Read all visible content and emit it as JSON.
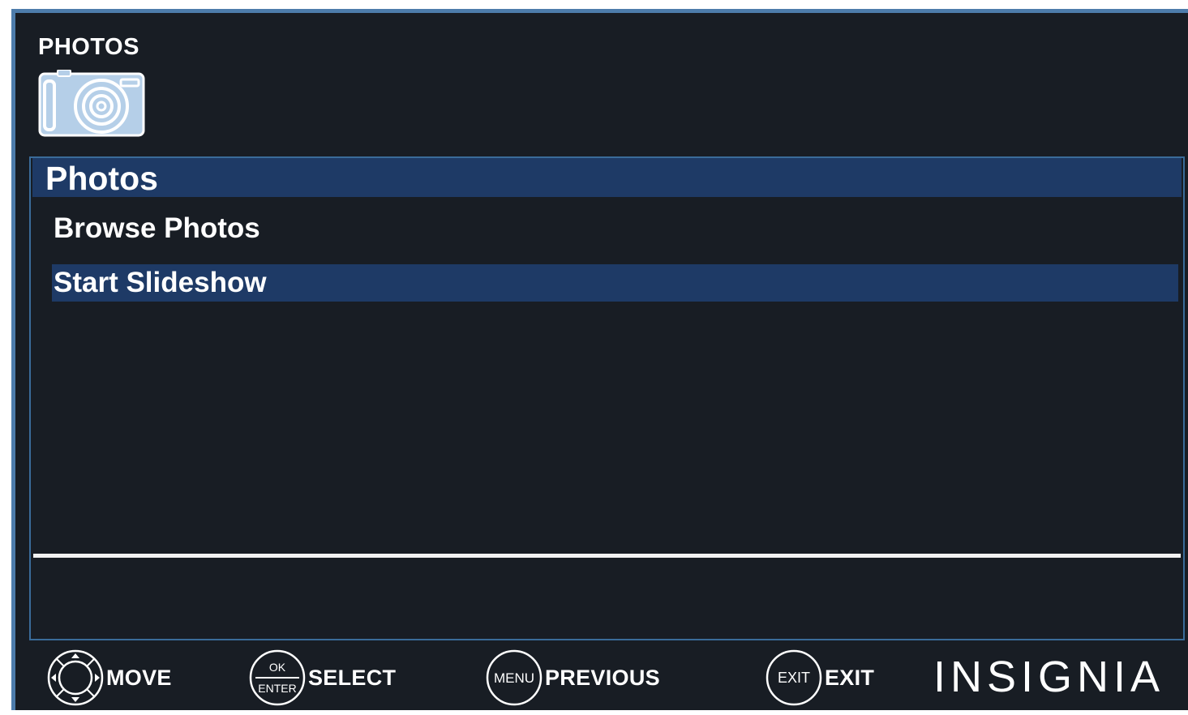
{
  "header": {
    "title": "PHOTOS",
    "icon": "camera-icon"
  },
  "panel": {
    "title": "Photos",
    "items": [
      {
        "label": "Browse Photos",
        "selected": false
      },
      {
        "label": "Start Slideshow",
        "selected": true
      }
    ]
  },
  "footer": {
    "hints": [
      {
        "icon": "dpad-icon",
        "label": "MOVE"
      },
      {
        "icon": "ok-enter-icon",
        "icon_text_top": "OK",
        "icon_text_bottom": "ENTER",
        "label": "SELECT"
      },
      {
        "icon": "menu-button-icon",
        "icon_text": "MENU",
        "label": "PREVIOUS"
      },
      {
        "icon": "exit-button-icon",
        "icon_text": "EXIT",
        "label": "EXIT"
      }
    ],
    "brand": "INSIGNIA"
  },
  "colors": {
    "background": "#181d24",
    "frame": "#4d7cab",
    "highlight": "#1e3a66",
    "text": "#ffffff"
  }
}
